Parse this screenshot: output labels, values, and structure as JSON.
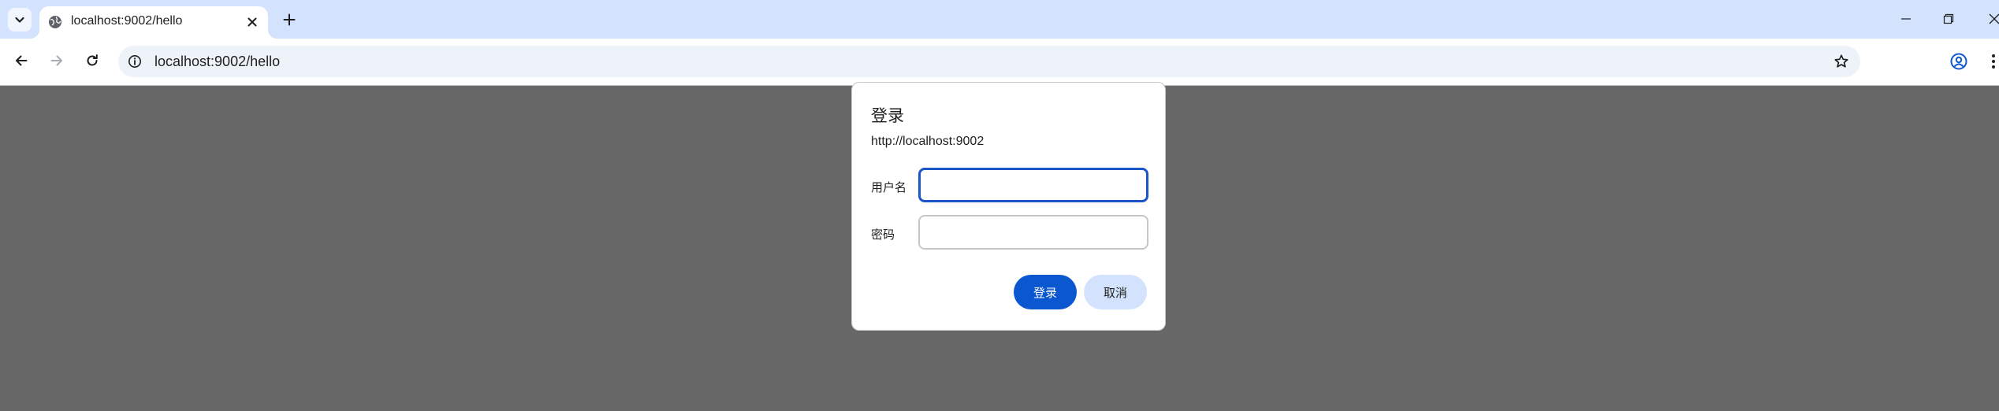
{
  "browser": {
    "tab": {
      "title": "localhost:9002/hello",
      "favicon": "globe-icon"
    },
    "icons": {
      "tab_search": "chevron-down-icon",
      "tab_close": "close-icon",
      "new_tab": "plus-icon",
      "minimize": "minimize-icon",
      "restore": "restore-icon",
      "window_close": "close-icon"
    },
    "colors": {
      "tabstrip": "#d3e3fd",
      "content_overlay": "#676767",
      "accent": "#0b57d0"
    }
  },
  "toolbar": {
    "url": "localhost:9002/hello",
    "icons": {
      "back": "arrow-left-icon",
      "forward": "arrow-right-icon",
      "reload": "reload-icon",
      "site_info": "info-icon",
      "bookmark": "star-icon",
      "profile": "profile-icon",
      "menu": "more-vertical-icon"
    }
  },
  "dialog": {
    "title": "登录",
    "origin": "http://localhost:9002",
    "username_label": "用户名",
    "username_value": "",
    "password_label": "密码",
    "password_value": "",
    "ok_label": "登录",
    "cancel_label": "取消"
  }
}
